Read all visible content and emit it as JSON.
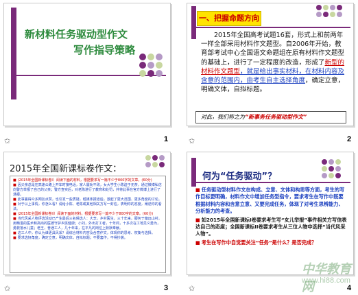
{
  "slides": [
    {
      "number": "1",
      "title_line1": "新材料任务驱动型作文",
      "title_line2": "写作指导策略",
      "colors": {
        "title": "#2e8b3e",
        "accent": "#7a2a7a"
      }
    },
    {
      "number": "2",
      "heading": "一、把握命题方向",
      "body_before": "2015年全国高考试题16套，形式上和前两年一样全部采用材料作文题型。自2006年开始，教育部考试中心全国语文命题组在原有材料作文题型的基础上，进行了一定程度的改造，形成了",
      "highlight1": "新型的材料作文题型",
      "body_mid": "，就是给出事实材料，在材料内容及含意的范围内，由考生自主选择角度",
      "body_after": "，确定立意，明确文体，自拟标题。",
      "footer_prefix": "对此，我们称之为",
      "footer_quote": "“新事务任务驱动型作文”"
    },
    {
      "number": "3",
      "title": "2015年全国新课标卷作文：",
      "items": [
        "(2015年全国新课标卷I）阅读下面的材料，根据要求写一篇不少于800字的文章。(60分)",
        "因父亲总是在高速公路上开车时接电话，家人屡劝不改，女大学生小陈迫于无奈，通过微博私信向警方举报了自己的父亲；警方查实后，对老陈进行了教育和处罚，并将此事在官方微博上进行了通报。",
        "此事赢得众多网友点赞，也引发一些质疑，经媒体报道后，激起了更大范围、更多角度的讨论。",
        "对于以上事情，你怎么看？请给小陈、老陈或其他相关方写一封信，表明你的态度，阐述你的看法。",
        "(2015年全国新课标卷II）阅读下面的材料，根据要求写一篇不少于800字的文章。(60分)",
        "当代风采人物评选活动已产生最后三名候选人：大李，乡村医生，三十年来，服务于偏远山村，用精湛的医术和高尚的医德守护乡民健康；小刘，外出打工者，十年间，十多次在工地见义勇为，勇救落水儿童；老王，普通工人，几十年来，在平凡的岗位上默默奉献。",
        "这三人中，你认为谁更具风采？请综合材料内容及含意作文，体现你的思考、权衡与选择。",
        "要求选好角度，确定立意，明确文体，自拟标题；不要套作，不得抄袭。"
      ]
    },
    {
      "number": "4",
      "title": "何为“任务驱动”？",
      "p1": "任务驱动型材料作文在构成、立意、文体和构思等方面，考生的写作目标更明确，材料作文中增加任务型指令，要求考生在写作中既要根据材料内容和含意立意、又要完成任务，体现了对考生思辨能力、分析能力的考查。",
      "p2": "如2015年全国新课标I卷要求考生写“女儿举报”事件相关方写信表达自己的态度；全国新课标II卷要求考生从三位人物中选择“当代风采人物”。",
      "p3": "考生在写作中自觉要关注“任务”是什么？是否完成？"
    }
  ],
  "watermark": {
    "line1": "中华教育网",
    "line2": "www.hi88.com"
  }
}
